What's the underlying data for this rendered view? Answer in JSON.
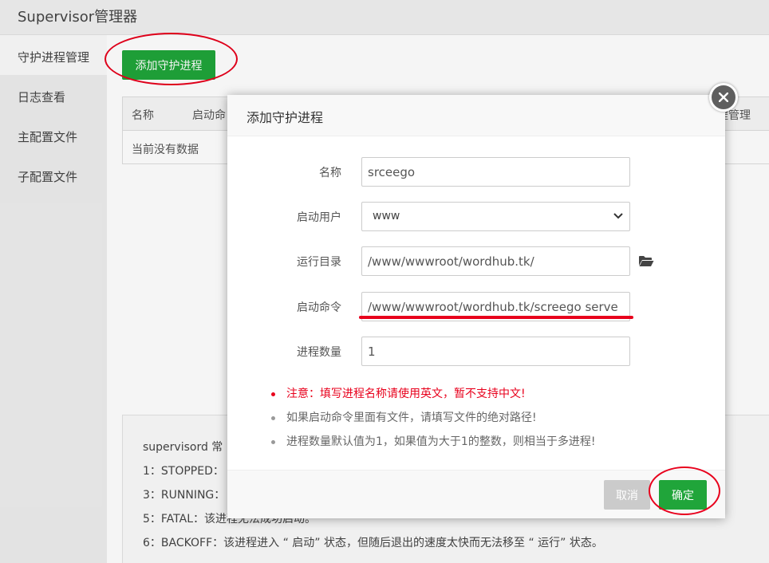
{
  "app": {
    "title": "Supervisor管理器"
  },
  "sidebar": {
    "items": [
      {
        "label": "守护进程管理"
      },
      {
        "label": "日志查看"
      },
      {
        "label": "主配置文件"
      },
      {
        "label": "子配置文件"
      }
    ]
  },
  "main": {
    "add_button_label": "添加守护进程",
    "table": {
      "headers": [
        "名称",
        "启动命",
        "程管理"
      ],
      "empty_text": "当前没有数据"
    },
    "info_lines": [
      "supervisord 常",
      "1：STOPPED：",
      "3：RUNNING：",
      "5：FATAL：该进程无法成功启动。",
      "6：BACKOFF：该进程进入 “ 启动” 状态，但随后退出的速度太快而无法移至 “ 运行” 状态。"
    ]
  },
  "dialog": {
    "title": "添加守护进程",
    "fields": {
      "name": {
        "label": "名称",
        "value": "srceego"
      },
      "user": {
        "label": "启动用户",
        "value": "www"
      },
      "dir": {
        "label": "运行目录",
        "value": "/www/wwwroot/wordhub.tk/"
      },
      "command": {
        "label": "启动命令",
        "value": "/www/wwwroot/wordhub.tk/screego serve"
      },
      "count": {
        "label": "进程数量",
        "value": "1"
      }
    },
    "notes": [
      "注意：填写进程名称请使用英文，暂不支持中文!",
      "如果启动命令里面有文件，请填写文件的绝对路径!",
      "进程数量默认值为1，如果值为大于1的整数，则相当于多进程!"
    ],
    "cancel_label": "取消",
    "ok_label": "确定"
  },
  "icons": {
    "close": "close-icon",
    "folder": "folder-open-icon",
    "select_arrow": "chevron-down-icon"
  },
  "colors": {
    "accent": "#20a53a",
    "warning": "#e8001c",
    "cancel_disabled": "#cbcbcb"
  }
}
